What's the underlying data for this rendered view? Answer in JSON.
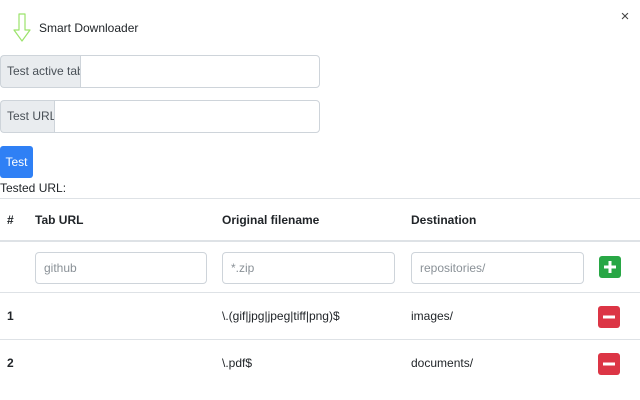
{
  "app": {
    "title": "Smart Downloader",
    "close_symbol": "×"
  },
  "form": {
    "active_tab_label": "Test active tab",
    "active_tab_value": "",
    "url_label": "Test URL",
    "url_value": "",
    "test_button_label": "Test",
    "tested_url_label": "Tested URL:"
  },
  "table": {
    "headers": {
      "num": "#",
      "tab_url": "Tab URL",
      "original_filename": "Original filename",
      "destination": "Destination"
    },
    "new_rule": {
      "tab_url_placeholder": "github",
      "original_filename_placeholder": "*.zip",
      "destination_placeholder": "repositories/"
    },
    "rows": [
      {
        "num": "1",
        "tab_url": "",
        "original_filename": "\\.(gif|jpg|jpeg|tiff|png)$",
        "destination": "images/"
      },
      {
        "num": "2",
        "tab_url": "",
        "original_filename": "\\.pdf$",
        "destination": "documents/"
      }
    ]
  },
  "colors": {
    "primary": "#2f80f5",
    "success": "#28a745",
    "danger": "#dc3545",
    "logo_green": "#9be36b"
  },
  "icons": {
    "logo": "down-arrow-icon",
    "close": "close-icon",
    "add": "plus-icon",
    "remove": "minus-icon"
  }
}
